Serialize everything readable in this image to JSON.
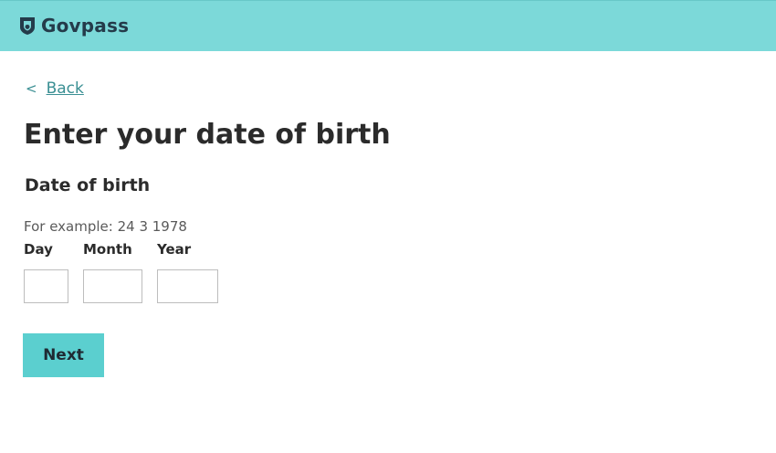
{
  "colors": {
    "header_bg": "#7cd9d9",
    "brand_text": "#243b4a",
    "link": "#3a8f93",
    "button_bg": "#5bcfcf"
  },
  "header": {
    "logo_icon": "shield-icon",
    "brand_name": "Govpass"
  },
  "nav": {
    "back_chevron": "<",
    "back_label": "Back"
  },
  "page": {
    "title": "Enter your date of birth"
  },
  "dob": {
    "legend": "Date of birth",
    "hint": "For example: 24 3 1978",
    "day_label": "Day",
    "month_label": "Month",
    "year_label": "Year",
    "day_value": "",
    "month_value": "",
    "year_value": ""
  },
  "actions": {
    "next_label": "Next"
  }
}
